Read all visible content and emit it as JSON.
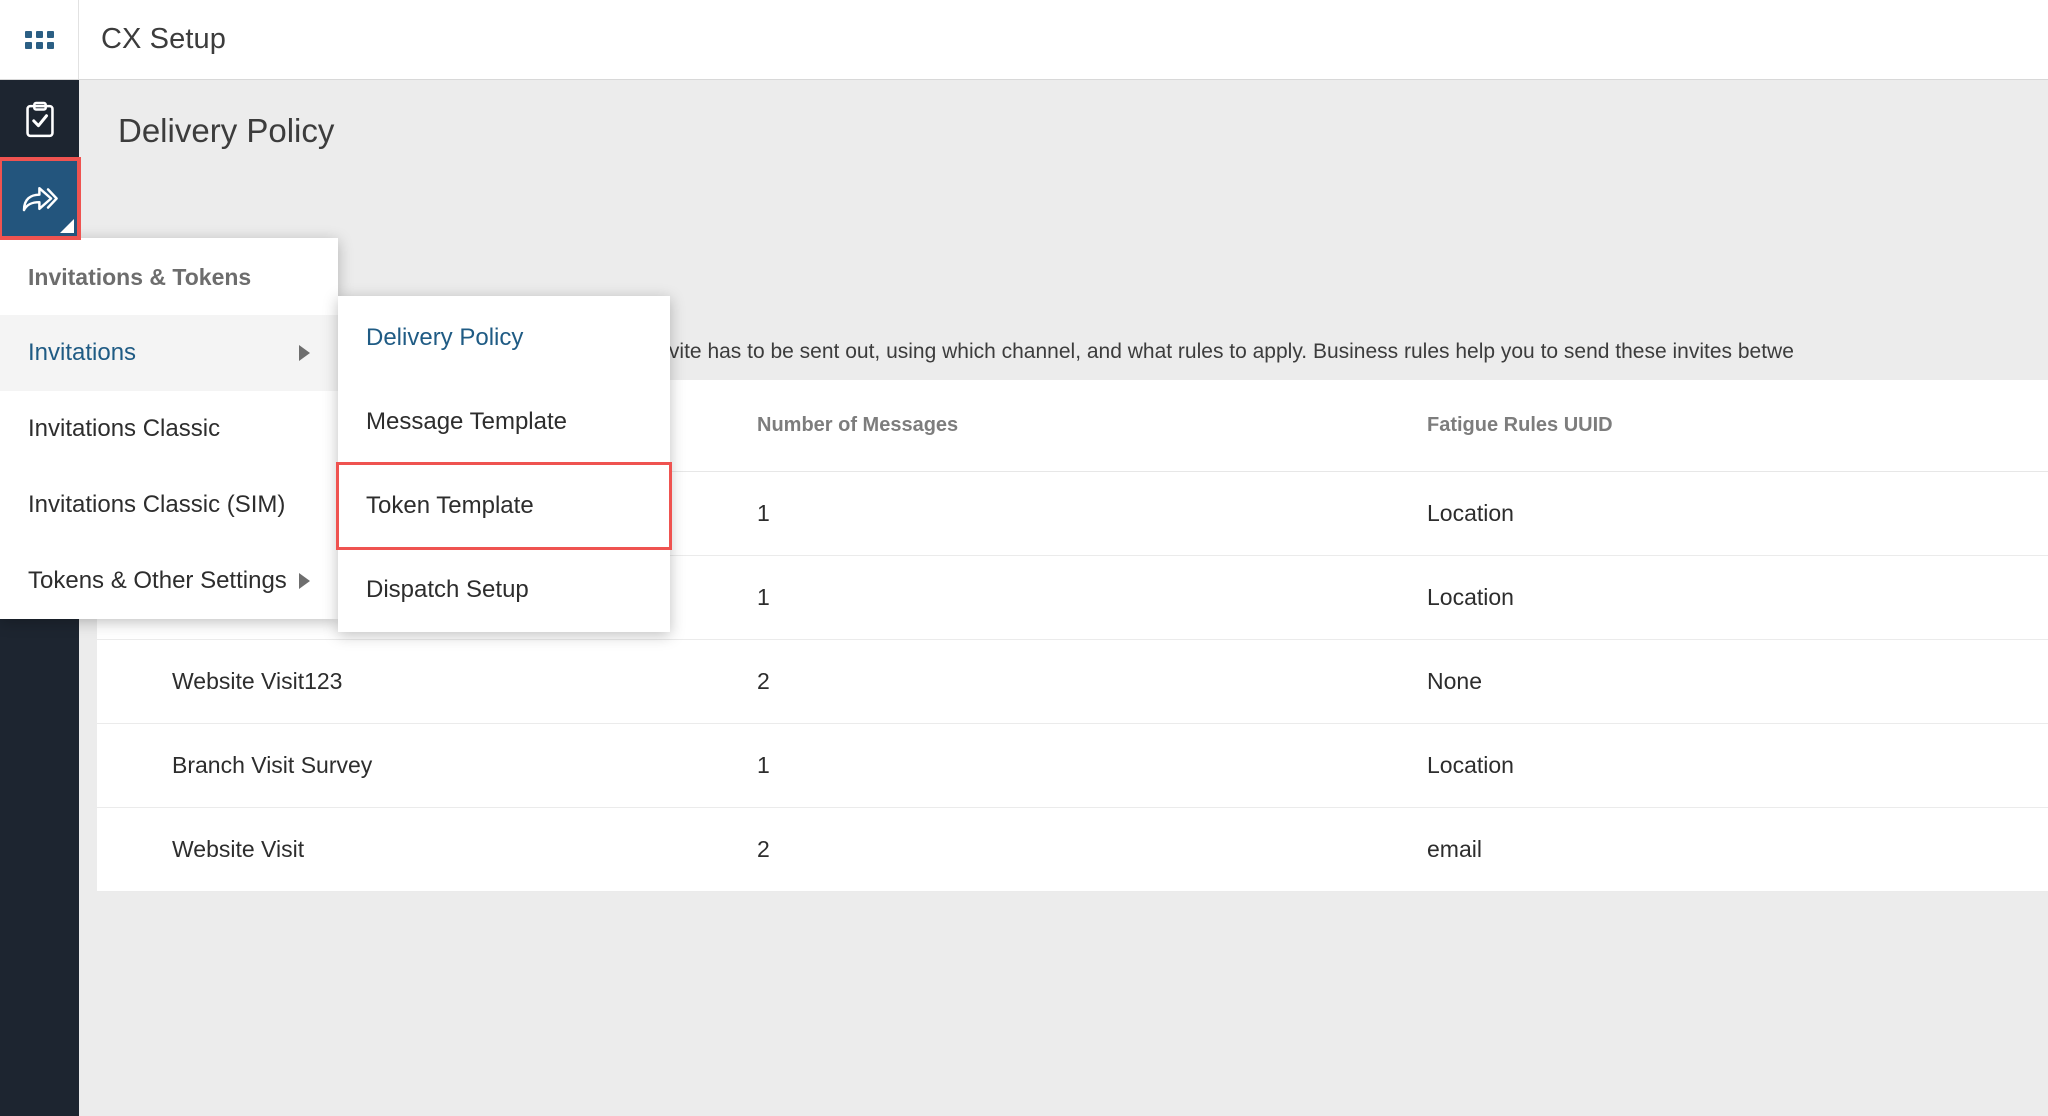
{
  "topbar": {
    "waffle_icon": "grid-apps-icon",
    "title": "CX Setup"
  },
  "rail": {
    "items": [
      {
        "icon": "clipboard-check-icon",
        "name": "surveys",
        "active": false,
        "highlighted": false
      },
      {
        "icon": "share-arrow-icon",
        "name": "invitations-tokens",
        "active": true,
        "highlighted": true
      }
    ]
  },
  "page": {
    "title": "Delivery Policy",
    "description": "A Delivery Policy is a set of rules that determine when an invite has to be sent out, using which channel, and what rules to apply. Business rules help you to send these invites betwe"
  },
  "table": {
    "columns": [
      "",
      "Number of Messages",
      "Fatigue Rules UUID"
    ],
    "rows": [
      {
        "name": "",
        "messages": "1",
        "uuid": "Location"
      },
      {
        "name": "",
        "messages": "1",
        "uuid": "Location"
      },
      {
        "name": "Website Visit123",
        "messages": "2",
        "uuid": "None"
      },
      {
        "name": "Branch Visit Survey",
        "messages": "1",
        "uuid": "Location"
      },
      {
        "name": "Website Visit",
        "messages": "2",
        "uuid": "email"
      }
    ]
  },
  "menu1": {
    "header": "Invitations & Tokens",
    "items": [
      {
        "label": "Invitations",
        "has_submenu": true,
        "selected": true
      },
      {
        "label": "Invitations Classic",
        "has_submenu": false,
        "selected": false
      },
      {
        "label": "Invitations Classic (SIM)",
        "has_submenu": false,
        "selected": false
      },
      {
        "label": "Tokens & Other Settings",
        "has_submenu": true,
        "selected": false
      }
    ]
  },
  "menu2": {
    "items": [
      {
        "label": "Delivery Policy",
        "active": true,
        "highlighted": false
      },
      {
        "label": "Message Template",
        "active": false,
        "highlighted": false
      },
      {
        "label": "Token Template",
        "active": false,
        "highlighted": true
      },
      {
        "label": "Dispatch Setup",
        "active": false,
        "highlighted": false
      }
    ]
  },
  "colors": {
    "rail_bg": "#1d2530",
    "rail_active": "#23557d",
    "highlight": "#ef5350",
    "link": "#1f5b84",
    "page_bg": "#ececec"
  }
}
